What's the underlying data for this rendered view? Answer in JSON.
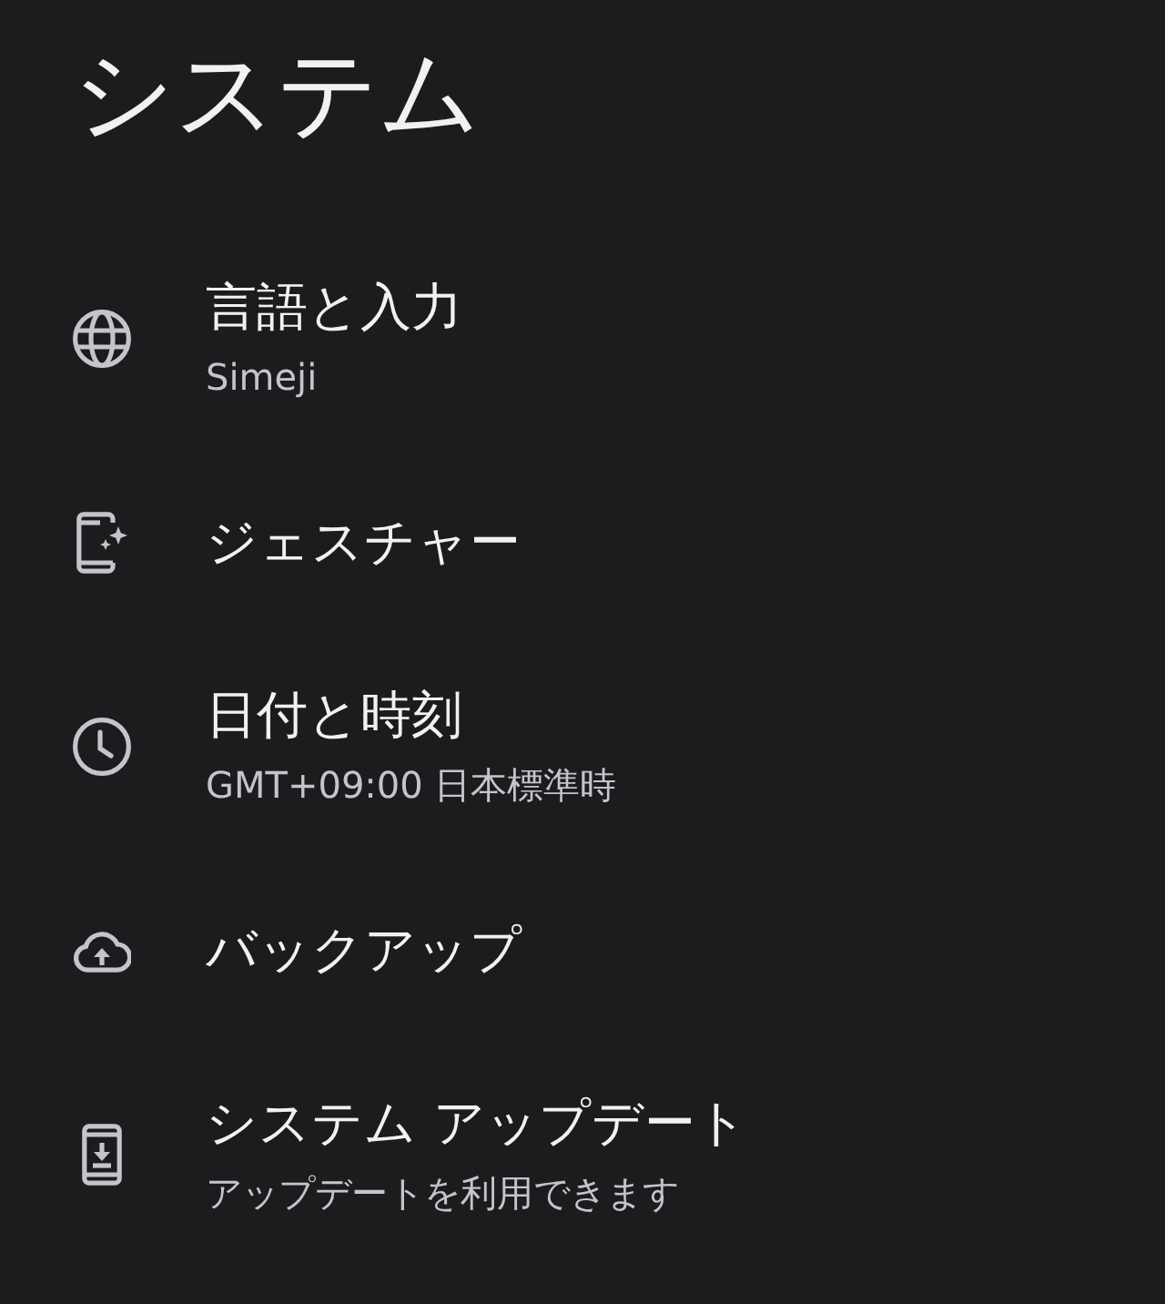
{
  "title": "システム",
  "items": [
    {
      "title": "言語と入力",
      "subtitle": "Simeji"
    },
    {
      "title": "ジェスチャー"
    },
    {
      "title": "日付と時刻",
      "subtitle": "GMT+09:00 日本標準時"
    },
    {
      "title": "バックアップ"
    },
    {
      "title": "システム アップデート",
      "subtitle": "アップデートを利用できます"
    }
  ]
}
